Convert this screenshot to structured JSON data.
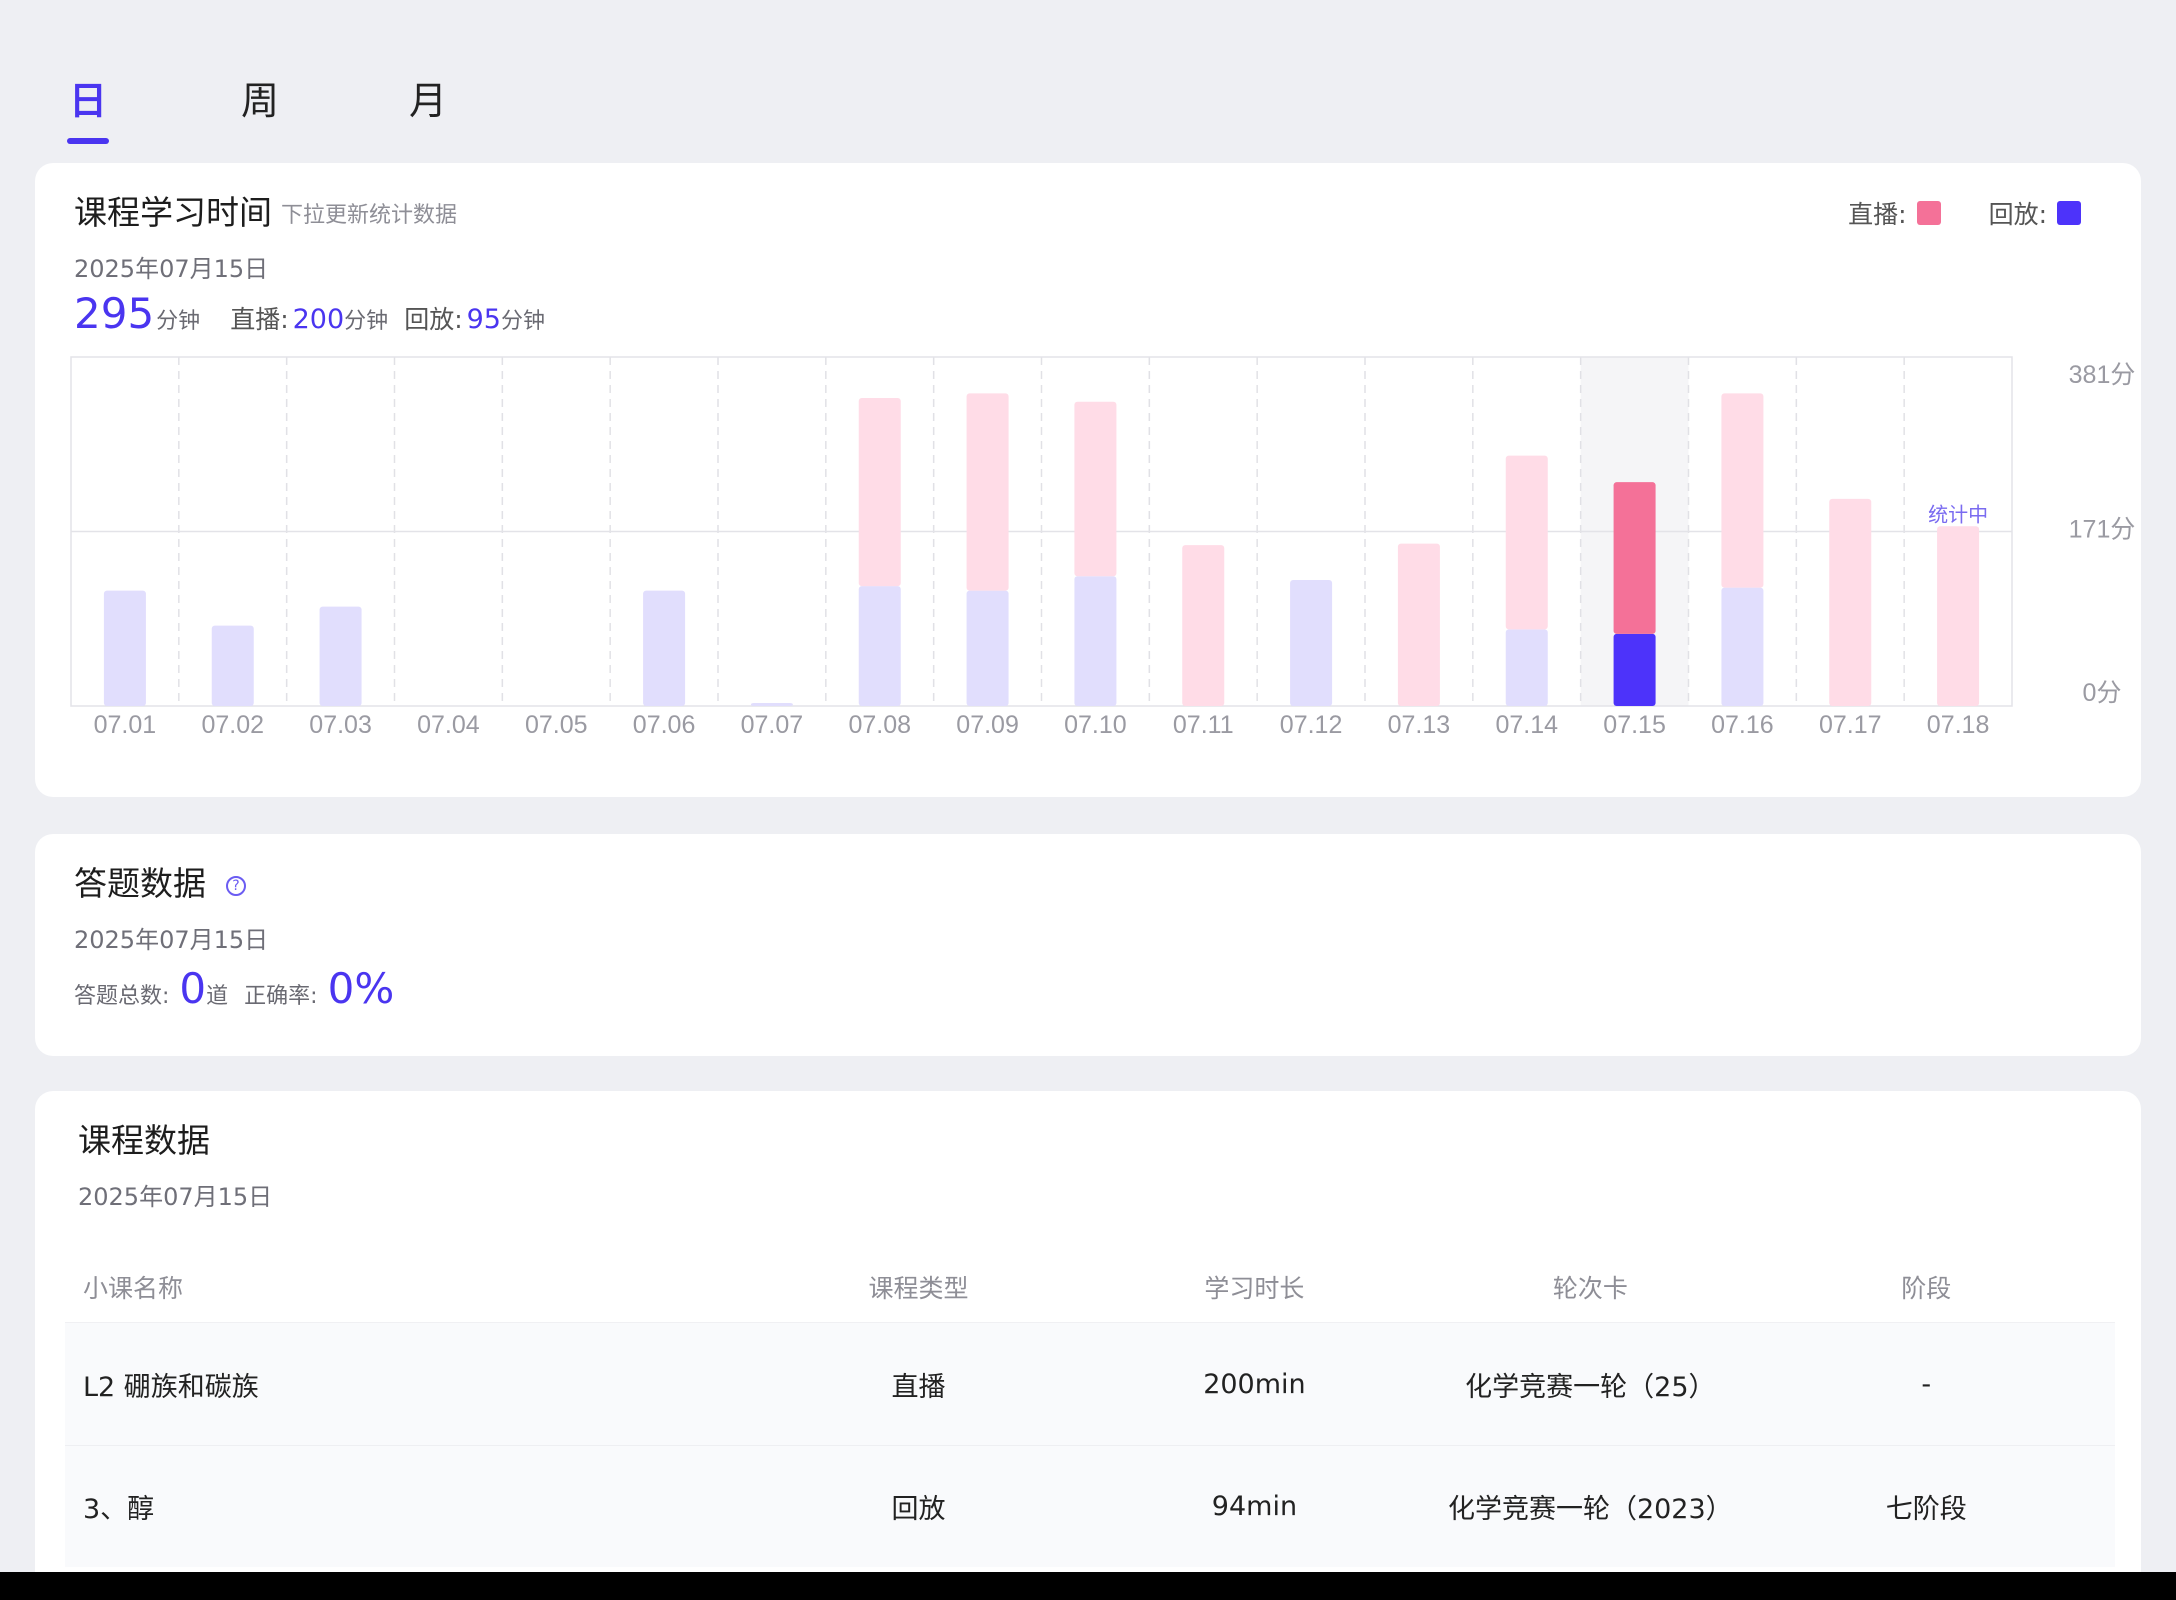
{
  "tabs": [
    {
      "label": "日",
      "active": true
    },
    {
      "label": "周",
      "active": false
    },
    {
      "label": "月",
      "active": false
    }
  ],
  "study_time": {
    "title": "课程学习时间",
    "hint": "下拉更新统计数据",
    "legend": {
      "live_label": "直播:",
      "replay_label": "回放:"
    },
    "date": "2025年07月15日",
    "total": "295",
    "unit": "分钟",
    "live_label": "直播:",
    "live_value": "200",
    "replay_label": "回放:",
    "replay_value": "95"
  },
  "answer_data": {
    "title": "答题数据",
    "date": "2025年07月15日",
    "total_label": "答题总数:",
    "total_value": "0",
    "total_unit": "道",
    "accuracy_label": "正确率:",
    "accuracy_value": "0%"
  },
  "course_data": {
    "title": "课程数据",
    "date": "2025年07月15日",
    "columns": [
      "小课名称",
      "课程类型",
      "学习时长",
      "轮次卡",
      "阶段"
    ],
    "rows": [
      {
        "name": "L2 硼族和碳族",
        "type": "直播",
        "duration": "200min",
        "card": "化学竞赛一轮（25）",
        "stage": "-"
      },
      {
        "name": "3、醇",
        "type": "回放",
        "duration": "94min",
        "card": "化学竞赛一轮（2023）",
        "stage": "七阶段"
      }
    ]
  },
  "colors": {
    "accent": "#4a35f0",
    "live": "#f47198",
    "replay": "#4d33fa",
    "live_light": "#ffdce7",
    "replay_light": "#e1defd"
  },
  "chart_data": {
    "type": "bar",
    "stacked": true,
    "categories": [
      "07.01",
      "07.02",
      "07.03",
      "07.04",
      "07.05",
      "07.06",
      "07.07",
      "07.08",
      "07.09",
      "07.10",
      "07.11",
      "07.12",
      "07.13",
      "07.14",
      "07.15",
      "07.16",
      "07.17",
      "07.18"
    ],
    "series": [
      {
        "name": "回放",
        "values": [
          152,
          106,
          131,
          0,
          0,
          152,
          4,
          158,
          152,
          171,
          0,
          166,
          0,
          101,
          95,
          156,
          0,
          0
        ]
      },
      {
        "name": "直播",
        "values": [
          0,
          0,
          0,
          0,
          0,
          0,
          0,
          248,
          260,
          230,
          212,
          0,
          214,
          229,
          200,
          256,
          273,
          237
        ]
      }
    ],
    "selected": "07.15",
    "y_ticks": [
      "0分",
      "171分",
      "381分"
    ],
    "ylim": [
      0,
      460
    ],
    "status_label": "统计中"
  }
}
